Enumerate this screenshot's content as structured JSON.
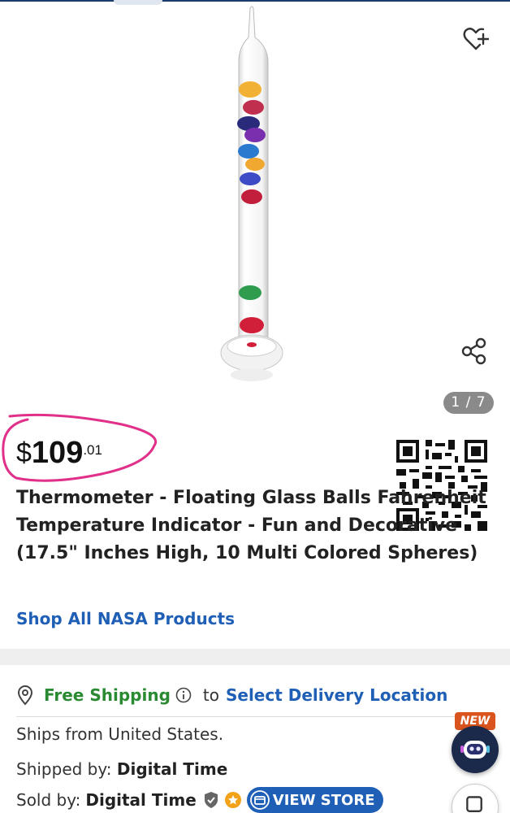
{
  "gallery": {
    "counter": "1 / 7",
    "wishlist_icon": "heart-plus-icon",
    "share_icon": "share-icon"
  },
  "price": {
    "currency": "$",
    "whole": "109",
    "cents": ".01"
  },
  "product": {
    "title": "Thermometer - Floating Glass Balls Fahrenheit Temperature Indicator - Fun and Decorative (17.5\" Inches High, 10 Multi Colored Spheres)",
    "shop_link": "Shop All NASA Products"
  },
  "shipping": {
    "free_label": "Free Shipping",
    "to_label": "to",
    "location_link": "Select Delivery Location",
    "ships_from": "Ships from United States.",
    "shipped_by_label": "Shipped by:",
    "shipped_by_value": "Digital Time",
    "sold_by_label": "Sold by:",
    "sold_by_value": "Digital Time",
    "view_store_label": "VIEW STORE"
  },
  "floating": {
    "new_badge": "NEW"
  },
  "colors": {
    "link_blue": "#1f5fb5",
    "free_green": "#2a8a32",
    "highlight_pink": "#e0308a",
    "badge_orange": "#d9541e"
  }
}
